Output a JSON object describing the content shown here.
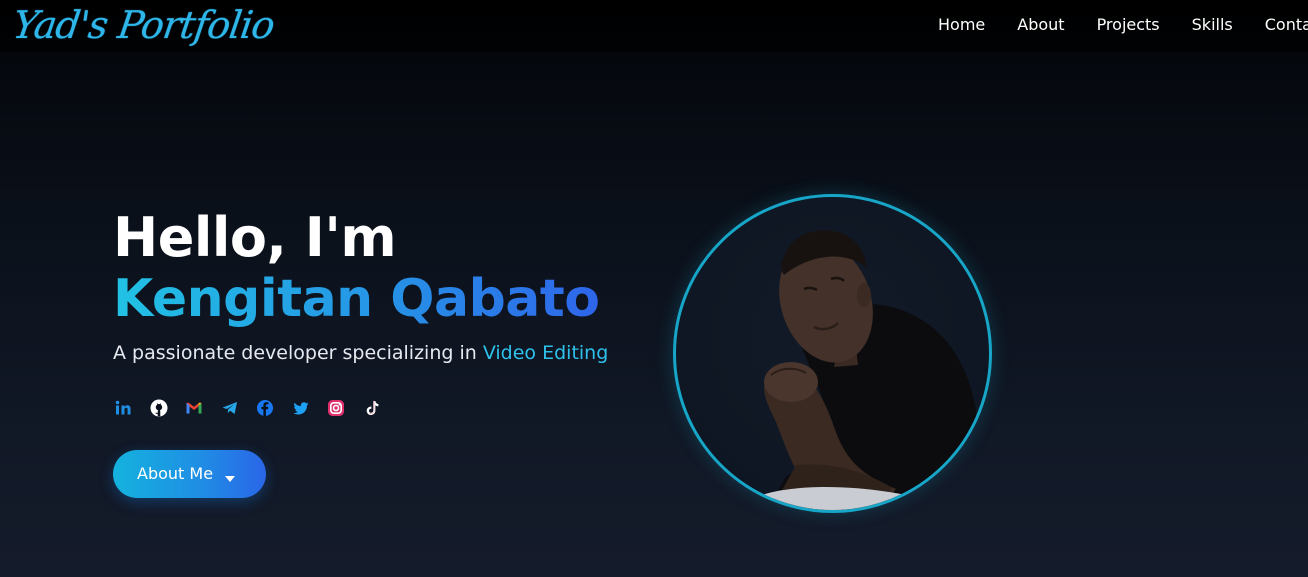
{
  "brand": {
    "logo_text": "Yad's Portfolio",
    "accent": "#2fb6e8"
  },
  "nav": {
    "items": [
      {
        "label": "Home"
      },
      {
        "label": "About"
      },
      {
        "label": "Projects"
      },
      {
        "label": "Skills"
      },
      {
        "label": "Contact"
      }
    ]
  },
  "hero": {
    "greeting": "Hello, I'm",
    "name": "Kengitan Qabato",
    "tagline_prefix": "A passionate developer specializing in ",
    "tagline_highlight": "Video Editing",
    "button_label": "About Me",
    "button_icon": "caret-down-icon",
    "gradient_colors": [
      "#21c2e4",
      "#2693e6",
      "#2f63ea"
    ]
  },
  "socials": [
    {
      "icon": "linkedin-icon",
      "color": "#1f8fe4"
    },
    {
      "icon": "github-icon",
      "color": "#ffffff"
    },
    {
      "icon": "gmail-icon",
      "color": "#ea4335"
    },
    {
      "icon": "telegram-icon",
      "color": "#27a7e7"
    },
    {
      "icon": "facebook-icon",
      "color": "#1877f2"
    },
    {
      "icon": "twitter-icon",
      "color": "#1da1f2"
    },
    {
      "icon": "instagram-icon",
      "color": "#e1306c"
    },
    {
      "icon": "tiktok-icon",
      "color": "#ffffff"
    }
  ],
  "profile_photo": {
    "icon": "profile-photo",
    "ring_color": "#17a6c8"
  }
}
